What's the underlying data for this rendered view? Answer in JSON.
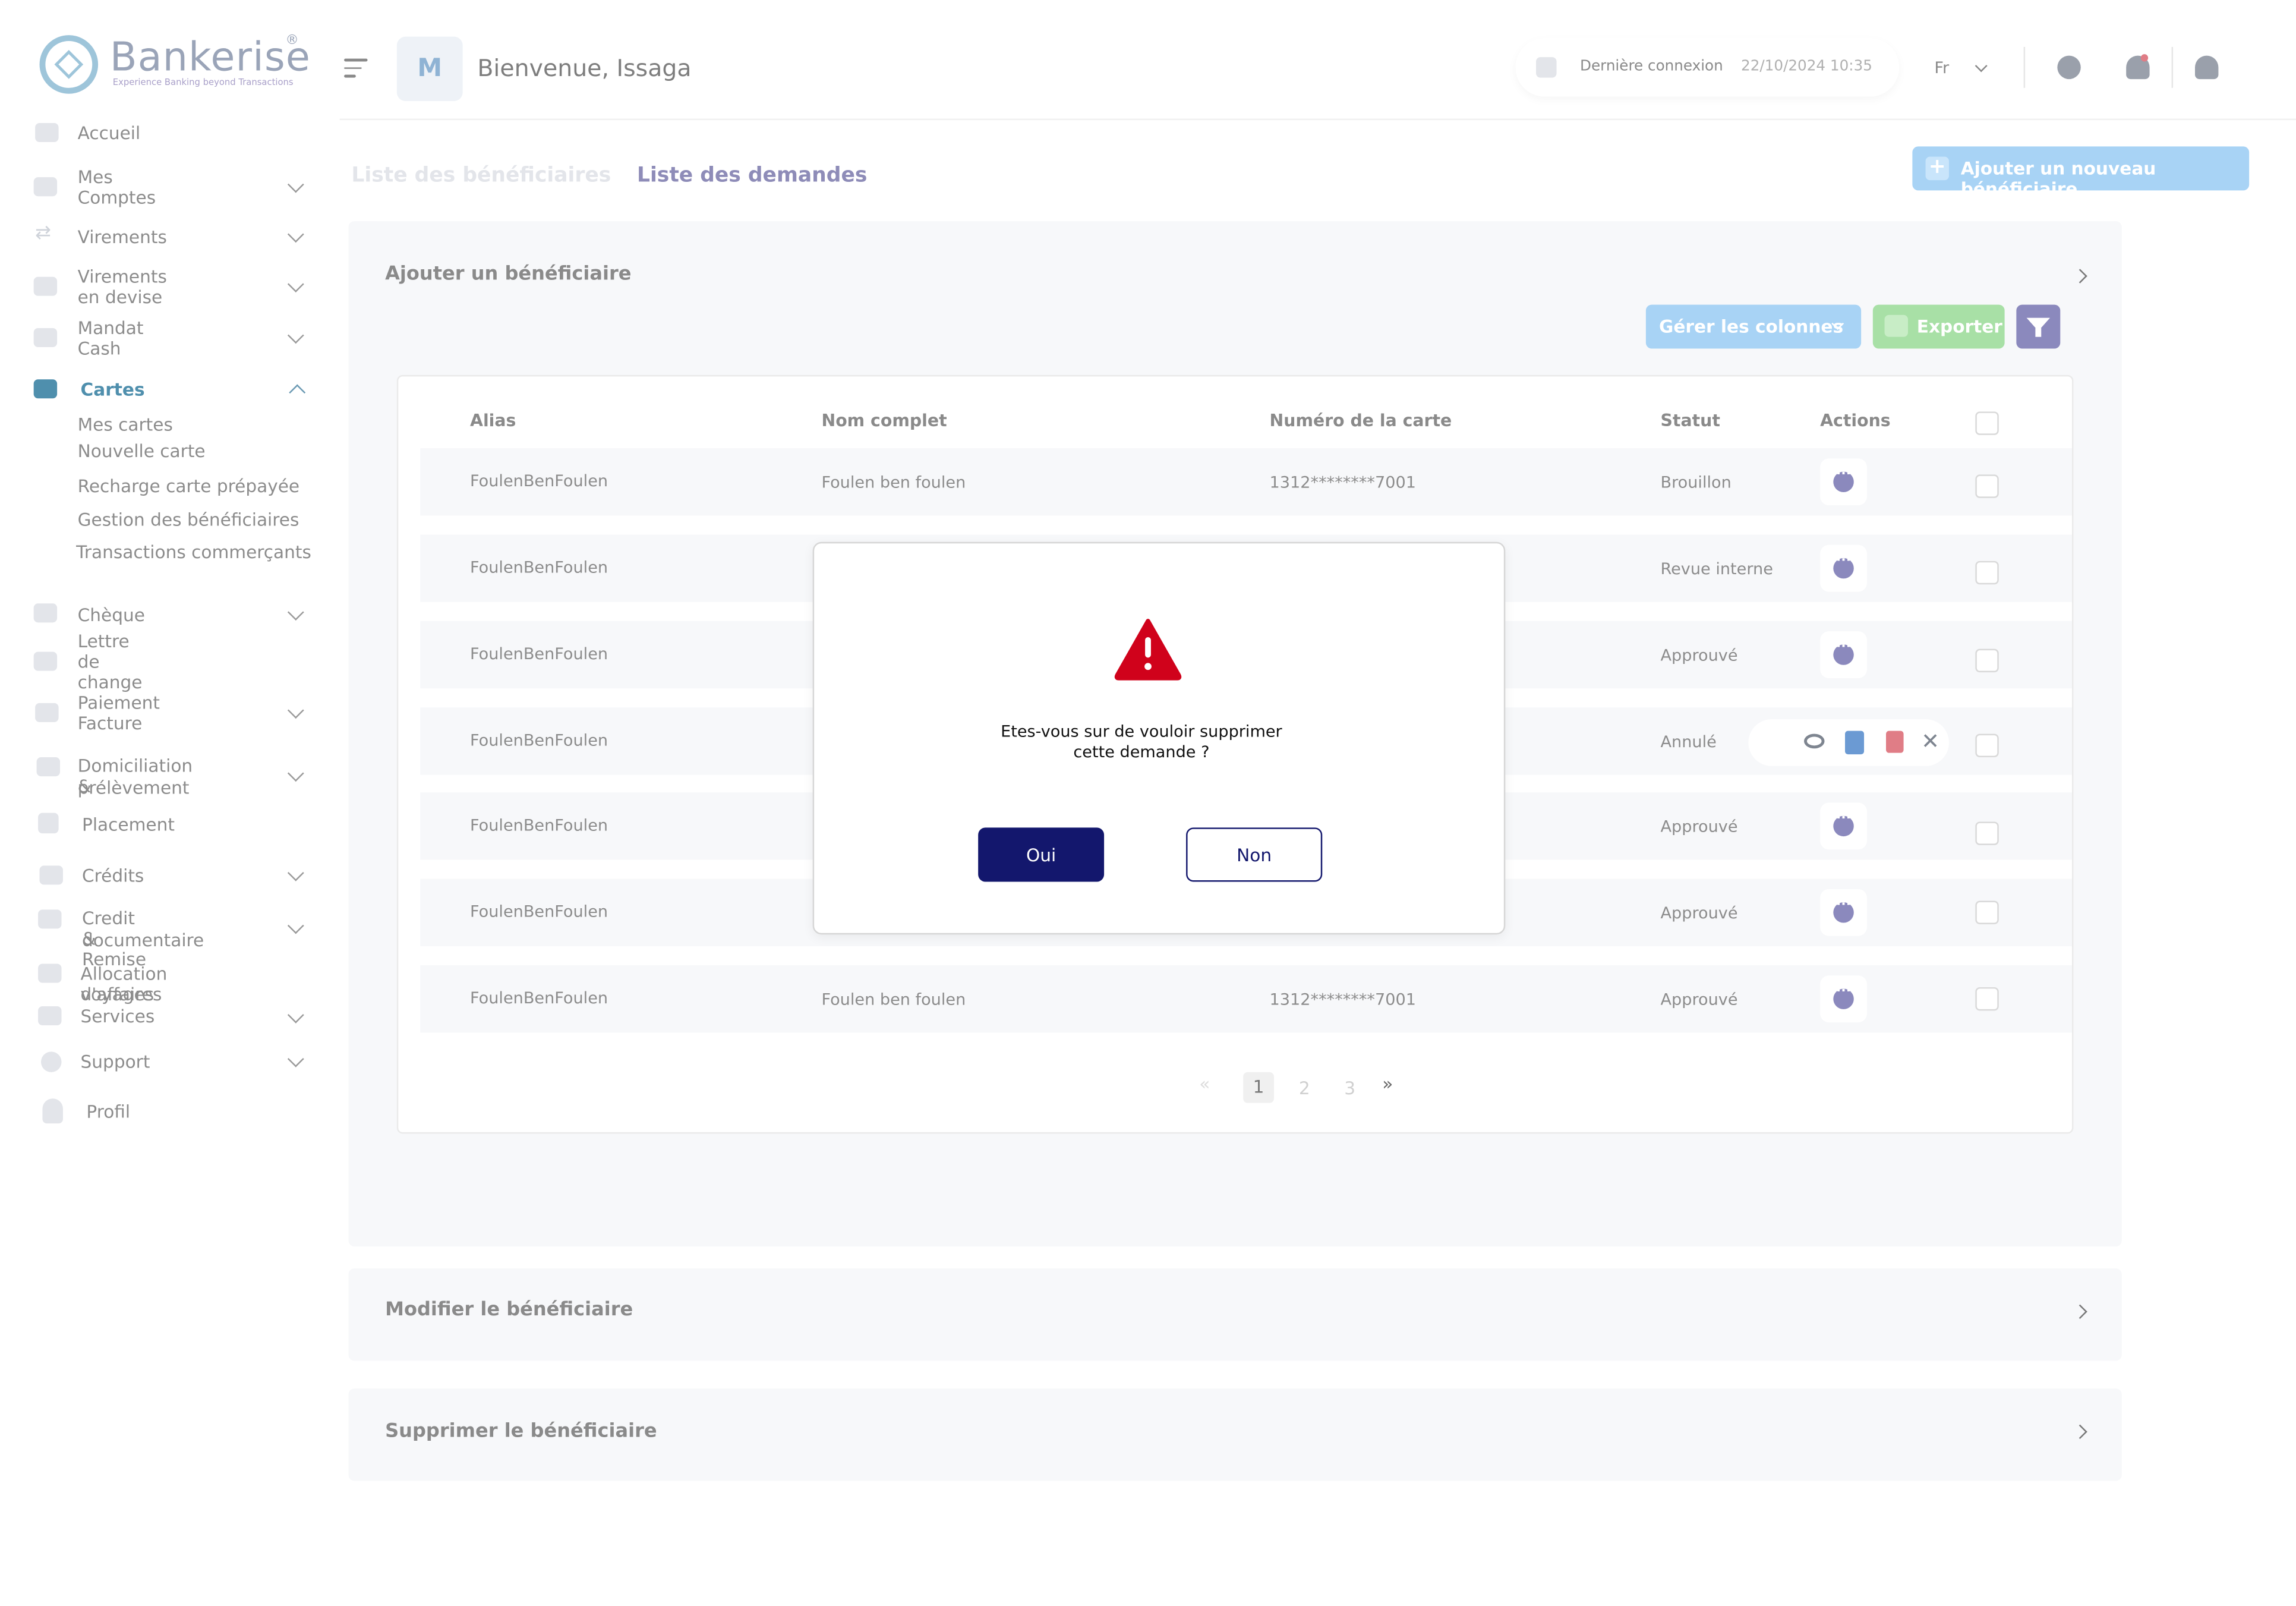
{
  "app": {
    "logo_text": "Bankerise",
    "logo_tagline": "Experience Banking beyond Transactions",
    "logo_reg": "®"
  },
  "header": {
    "avatar_letter": "M",
    "welcome": "Bienvenue, Issaga",
    "last_login_label": "Dernière connexion",
    "last_login_value": "22/10/2024 10:35",
    "language": "Fr"
  },
  "sidebar": {
    "items": [
      {
        "label": "Accueil"
      },
      {
        "label": "Mes Comptes"
      },
      {
        "label": "Virements"
      },
      {
        "label": "Virements en devise"
      },
      {
        "label": "Mandat Cash"
      },
      {
        "label": "Cartes"
      },
      {
        "label": "Chèque"
      },
      {
        "label": "Lettre de change"
      },
      {
        "label": "Paiement Facture"
      },
      {
        "label": "Domiciliation &"
      },
      {
        "label": "Placement"
      },
      {
        "label": "Crédits"
      },
      {
        "label": "Credit & Remise"
      },
      {
        "label": "Allocation  voyages"
      },
      {
        "label": "Support"
      },
      {
        "label": "Profil"
      }
    ],
    "domiciliation_line2": "prélèvement",
    "credit_line2": "documentaire",
    "allocation_line2": "d'affaires",
    "services": "Services",
    "cartes_sub": [
      "Mes cartes",
      "Nouvelle carte",
      "Recharge carte prépayée",
      "Gestion des bénéficiaires",
      "Transactions commerçants"
    ]
  },
  "tabs": {
    "tab1": "Liste des bénéficiaires",
    "tab2": "Liste des demandes"
  },
  "add_button": "Ajouter un nouveau bénéficiaire",
  "panel": {
    "title": "Ajouter un bénéficiaire",
    "manage_columns": "Gérer les colonnes",
    "export": "Exporter"
  },
  "table": {
    "columns": [
      "Alias",
      "Nom complet",
      "Numéro de la carte",
      "Statut",
      "Actions"
    ],
    "rows": [
      {
        "alias": "FoulenBenFoulen",
        "name": "Foulen ben foulen",
        "card": "1312********7001",
        "status": "Brouillon"
      },
      {
        "alias": "FoulenBenFoulen",
        "name": "",
        "card": "",
        "status": "Revue interne"
      },
      {
        "alias": "FoulenBenFoulen",
        "name": "",
        "card": "",
        "status": "Approuvé"
      },
      {
        "alias": "FoulenBenFoulen",
        "name": "",
        "card": "",
        "status": "Annulé"
      },
      {
        "alias": "FoulenBenFoulen",
        "name": "",
        "card": "",
        "status": "Approuvé"
      },
      {
        "alias": "FoulenBenFoulen",
        "name": "",
        "card": "",
        "status": "Approuvé"
      },
      {
        "alias": "FoulenBenFoulen",
        "name": "Foulen ben foulen",
        "card": "1312********7001",
        "status": "Approuvé"
      }
    ]
  },
  "pagination": {
    "prev": "«",
    "pages": [
      "1",
      "2",
      "3"
    ],
    "next": "»",
    "current": "1"
  },
  "modal": {
    "message_line1": "Etes-vous sur de vouloir  supprimer",
    "message_line2": "cette demande  ?",
    "yes": "Oui",
    "no": "Non"
  },
  "accordions": {
    "modify": "Modifier le bénéficiaire",
    "delete": "Supprimer le bénéficiaire"
  },
  "colors": {
    "primary": "#13176d",
    "accent_blue": "#a8d3f5",
    "export_green": "#a8e0a6",
    "filter_purple": "#8b89bd",
    "warning_red": "#d0021b",
    "delete_red": "#e07d86"
  }
}
